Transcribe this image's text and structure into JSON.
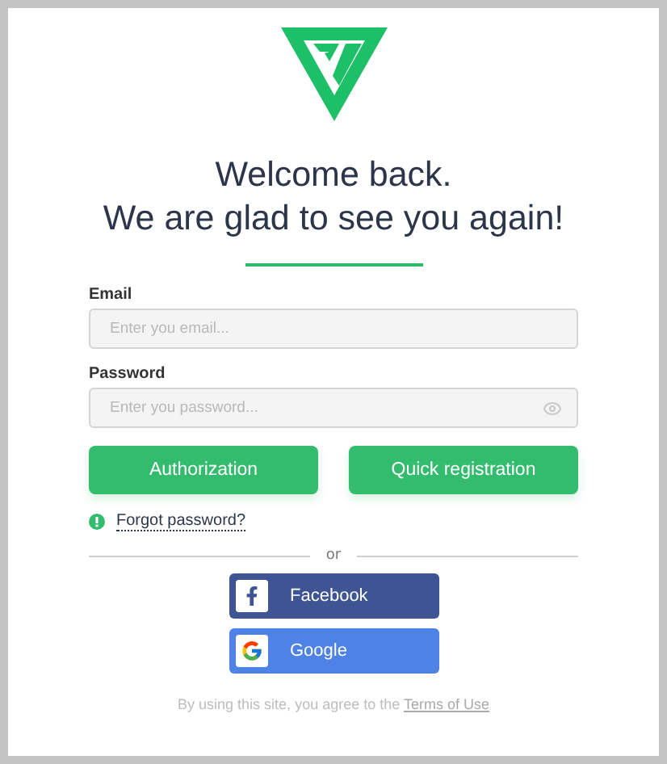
{
  "heading": [
    "Welcome back.",
    "We are glad to see you again!"
  ],
  "fields": [
    {
      "kind": "text",
      "label": "Email",
      "placeholder": "Enter you email..."
    },
    {
      "kind": "password",
      "label": "Password",
      "placeholder": "Enter you password..."
    }
  ],
  "actions": [
    "Authorization",
    "Quick registration"
  ],
  "forgot_link": "Forgot password?",
  "divider": "or",
  "social": [
    {
      "kind": "facebook",
      "label": "Facebook"
    },
    {
      "kind": "google",
      "label": "Google"
    }
  ],
  "terms": {
    "text": "By using this site, you agree to the ",
    "link": "Terms of Use"
  }
}
